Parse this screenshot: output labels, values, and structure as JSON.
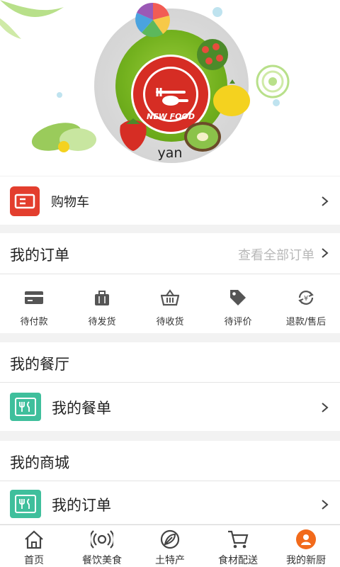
{
  "header": {
    "logo_text": "NEW FOOD",
    "username": "yan"
  },
  "cart": {
    "label": "购物车",
    "icon": "ticket-icon",
    "icon_color": "#e33e2e"
  },
  "orders": {
    "title": "我的订单",
    "view_all": "查看全部订单",
    "statuses": [
      {
        "label": "待付款",
        "icon": "card-icon"
      },
      {
        "label": "待发货",
        "icon": "bag-icon"
      },
      {
        "label": "待收货",
        "icon": "basket-icon"
      },
      {
        "label": "待评价",
        "icon": "tag-icon"
      },
      {
        "label": "退款/售后",
        "icon": "refund-icon"
      }
    ]
  },
  "restaurant": {
    "title": "我的餐厅",
    "menu_label": "我的餐单",
    "icon_color": "#3fbf9c"
  },
  "mall": {
    "title": "我的商城",
    "orders_label": "我的订单"
  },
  "tabbar": {
    "items": [
      {
        "label": "首页",
        "icon": "home-icon"
      },
      {
        "label": "餐饮美食",
        "icon": "signal-icon"
      },
      {
        "label": "土特产",
        "icon": "leaf-icon"
      },
      {
        "label": "食材配送",
        "icon": "cart-icon"
      },
      {
        "label": "我的新厨",
        "icon": "user-icon"
      }
    ],
    "active_color": "#f26a1b"
  }
}
